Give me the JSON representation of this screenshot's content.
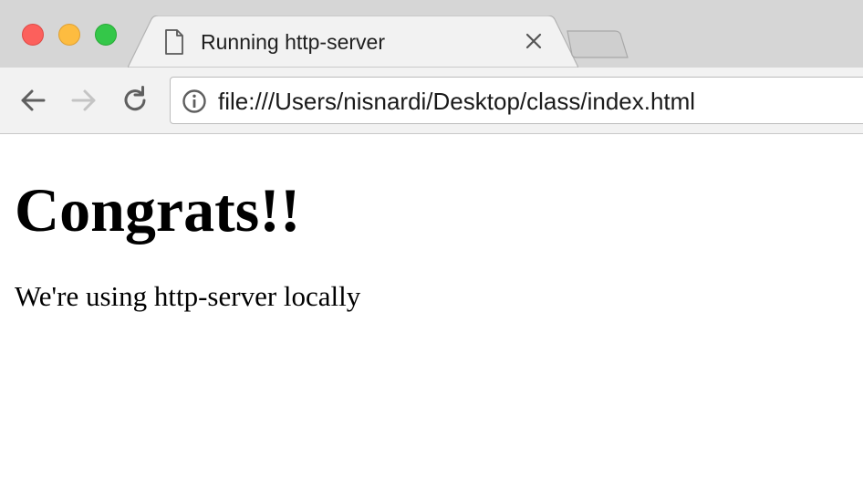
{
  "window": {
    "controls": {
      "close_color": "#fc605c",
      "minimize_color": "#fdbc40",
      "maximize_color": "#34c749"
    }
  },
  "tab": {
    "title": "Running http-server",
    "icon": "page-icon",
    "close_icon": "close-icon"
  },
  "toolbar": {
    "back_icon": "back-arrow-icon",
    "forward_icon": "forward-arrow-icon",
    "reload_icon": "reload-icon",
    "forward_enabled": false
  },
  "address_bar": {
    "icon": "info-icon",
    "url": "file:///Users/nisnardi/Desktop/class/index.html"
  },
  "page": {
    "heading": "Congrats!!",
    "paragraph": "We're using http-server locally"
  }
}
